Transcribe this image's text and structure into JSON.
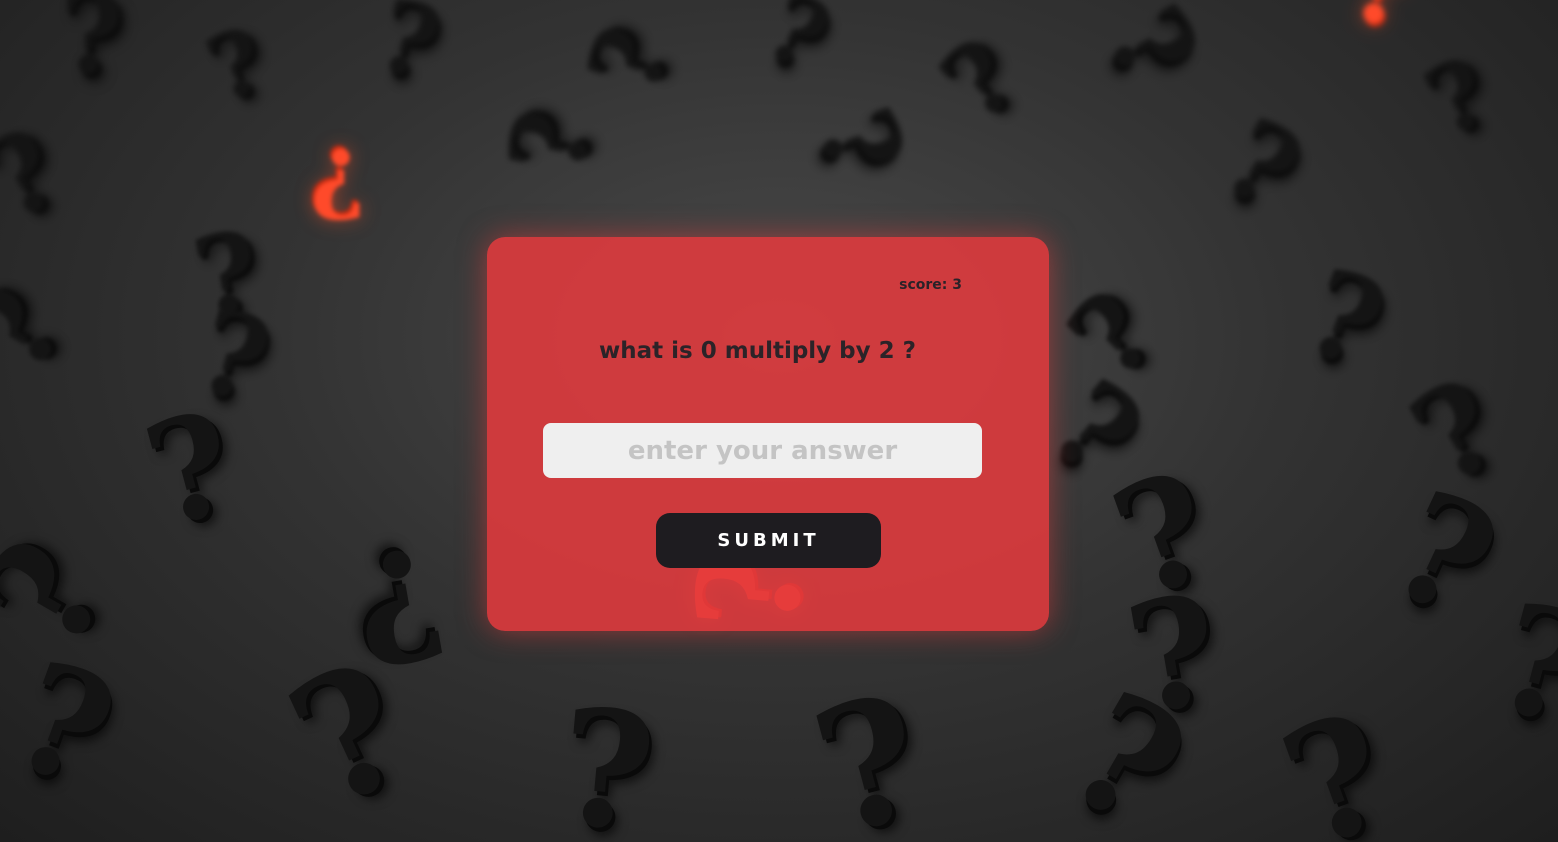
{
  "quiz": {
    "score_text": "score: 3",
    "question": "what is 0 multiply by 2 ?",
    "answer_placeholder": "enter your answer",
    "answer_value": "",
    "submit_label": "SUBMIT"
  },
  "background": {
    "description_icon": "question-mark-icon",
    "accent_color": "#ff4a2a",
    "base_color": "#333333"
  },
  "card": {
    "color": "#e23a3e"
  }
}
